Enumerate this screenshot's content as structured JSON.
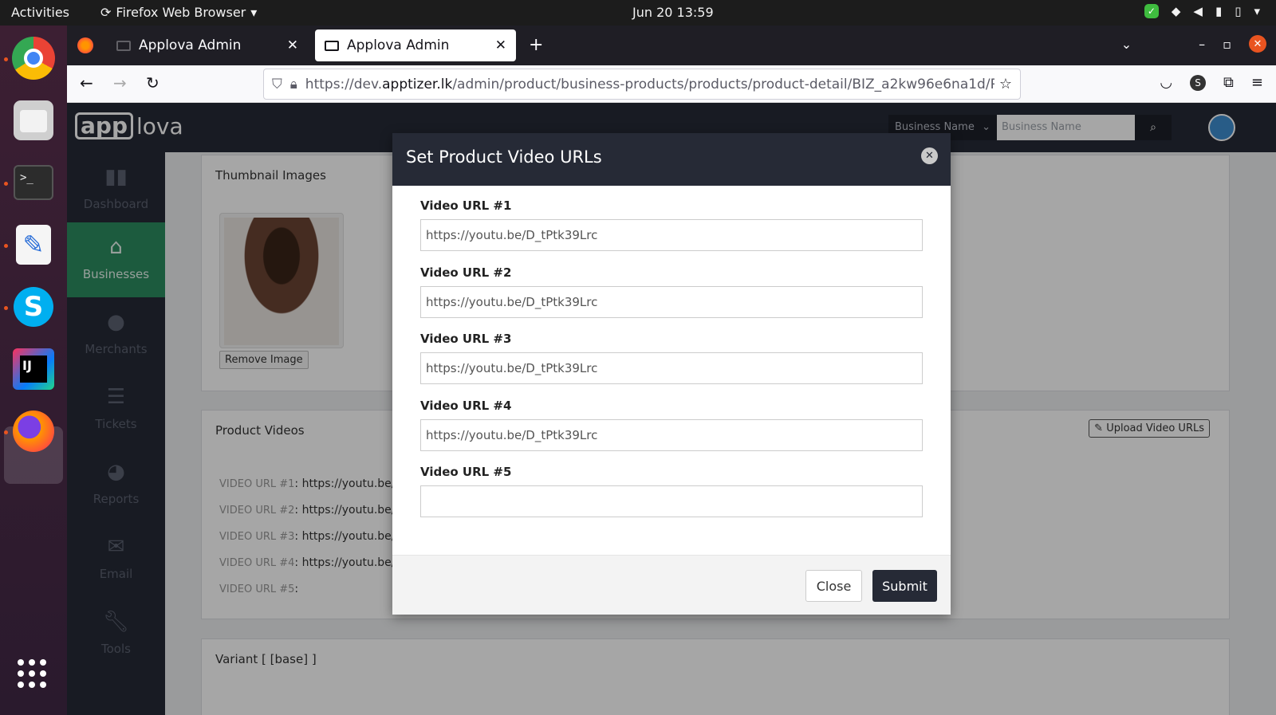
{
  "system": {
    "activities": "Activities",
    "app_menu": "Firefox Web Browser",
    "clock": "Jun 20  13:59"
  },
  "browser": {
    "tabs": [
      {
        "title": "Applova Admin"
      },
      {
        "title": "Applova Admin"
      }
    ],
    "url_prefix": "https://dev.",
    "url_domain": "apptizer.lk",
    "url_path": "/admin/product/business-products/products/product-detail/BIZ_a2kw96e6na1d/P"
  },
  "app": {
    "logo_app": "app",
    "logo_rest": "lova",
    "search_select": "Business Name",
    "search_placeholder": "Business Name"
  },
  "sidebar": {
    "items": [
      {
        "label": "Dashboard",
        "icon": "bar-chart-icon"
      },
      {
        "label": "Businesses",
        "icon": "home-icon"
      },
      {
        "label": "Merchants",
        "icon": "user-icon"
      },
      {
        "label": "Tickets",
        "icon": "list-icon"
      },
      {
        "label": "Reports",
        "icon": "pie-chart-icon"
      },
      {
        "label": "Email",
        "icon": "envelope-icon"
      },
      {
        "label": "Tools",
        "icon": "wrench-icon"
      }
    ]
  },
  "content": {
    "thumbnail_title": "Thumbnail Images",
    "remove_image": "Remove Image",
    "videos_title": "Product Videos",
    "upload_button": "Upload Video URLs",
    "video_lines": [
      {
        "label": "VIDEO URL #1",
        "value": ": https://youtu.be/"
      },
      {
        "label": "VIDEO URL #2",
        "value": ": https://youtu.be/"
      },
      {
        "label": "VIDEO URL #3",
        "value": ": https://youtu.be/"
      },
      {
        "label": "VIDEO URL #4",
        "value": ": https://youtu.be/"
      },
      {
        "label": "VIDEO URL #5",
        "value": ":"
      }
    ],
    "variant_title": "Variant [ [base] ]"
  },
  "modal": {
    "title": "Set Product Video URLs",
    "fields": [
      {
        "label": "Video URL #1",
        "value": "https://youtu.be/D_tPtk39Lrc"
      },
      {
        "label": "Video URL #2",
        "value": "https://youtu.be/D_tPtk39Lrc"
      },
      {
        "label": "Video URL #3",
        "value": "https://youtu.be/D_tPtk39Lrc"
      },
      {
        "label": "Video URL #4",
        "value": "https://youtu.be/D_tPtk39Lrc"
      },
      {
        "label": "Video URL #5",
        "value": ""
      }
    ],
    "close_label": "Close",
    "submit_label": "Submit"
  }
}
